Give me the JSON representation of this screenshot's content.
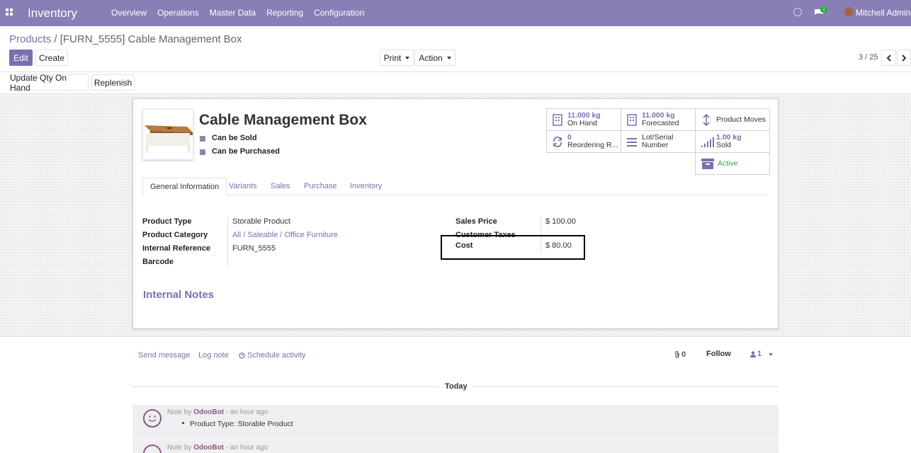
{
  "app": {
    "name": "Inventory"
  },
  "menu": [
    "Overview",
    "Operations",
    "Master Data",
    "Reporting",
    "Configuration"
  ],
  "systray": {
    "chat_badge": "1",
    "user": "Mitchell Admin"
  },
  "breadcrumb": {
    "parent": "Products",
    "separator": "/",
    "current": "[FURN_5555] Cable Management Box"
  },
  "actions": {
    "edit": "Edit",
    "create": "Create",
    "print": "Print",
    "action": "Action"
  },
  "pager": {
    "text": "3 / 25"
  },
  "header_buttons": {
    "update_qty": "Update Qty On Hand",
    "replenish": "Replenish"
  },
  "product": {
    "name": "Cable Management Box",
    "can_be_sold": "Can be Sold",
    "can_be_purchased": "Can be Purchased"
  },
  "smart_buttons": {
    "on_hand": {
      "value": "11.000 kg",
      "label": "On Hand"
    },
    "forecasted": {
      "value": "11.000 kg",
      "label": "Forecasted"
    },
    "moves": {
      "label": "Product Moves"
    },
    "reordering": {
      "value": "0",
      "label": "Reordering R..."
    },
    "lots": {
      "line1": "Lot/Serial",
      "line2": "Number"
    },
    "sold": {
      "value": "1.00 kg",
      "label": "Sold"
    },
    "active": {
      "label": "Active",
      "color": "#28a745"
    }
  },
  "tabs": [
    "General Information",
    "Variants",
    "Sales",
    "Purchase",
    "Inventory"
  ],
  "general": {
    "product_type_label": "Product Type",
    "product_type": "Storable Product",
    "category_label": "Product Category",
    "category": "All / Saleable / Office Furniture",
    "ref_label": "Internal Reference",
    "ref": "FURN_5555",
    "barcode_label": "Barcode",
    "sales_price_label": "Sales Price",
    "sales_price": "$ 100.00",
    "taxes_label": "Customer Taxes",
    "cost_label": "Cost",
    "cost": "$ 80.00"
  },
  "internal_notes": "Internal Notes",
  "chatter": {
    "send_message": "Send message",
    "log_note": "Log note",
    "schedule": "Schedule activity",
    "attachments": "0",
    "follow": "Follow",
    "followers": "1",
    "today": "Today",
    "messages": [
      {
        "prefix": "Note by",
        "author": "OdooBot",
        "time": "- an hour ago",
        "body": "Product Type: Storable Product"
      },
      {
        "prefix": "Note by",
        "author": "OdooBot",
        "time": "- an hour ago",
        "body": ""
      }
    ]
  },
  "colors": {
    "brand": "#8a7eb6",
    "accent": "#7c6fae",
    "active": "#28a745"
  }
}
